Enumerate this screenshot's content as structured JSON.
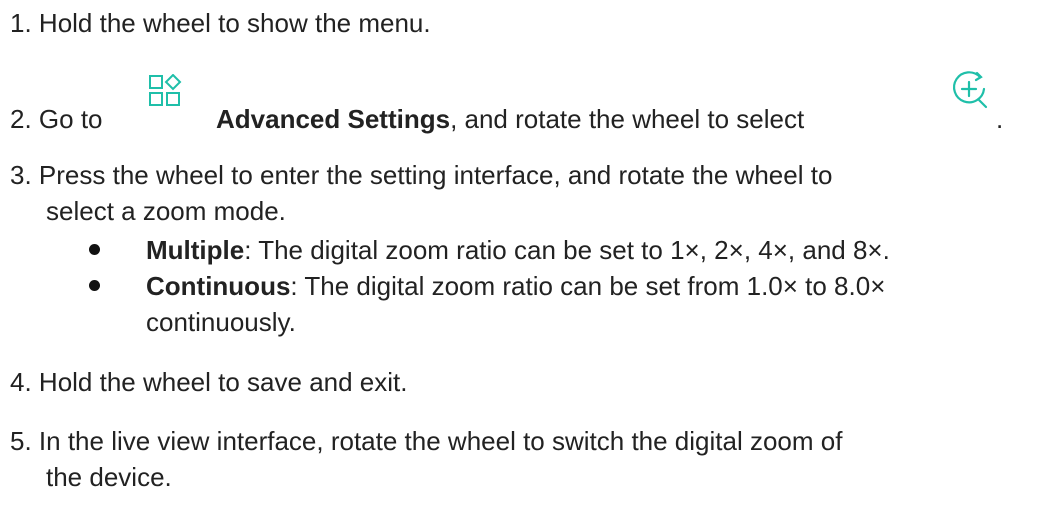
{
  "steps": [
    {
      "number": "1.",
      "text": "Hold the wheel to show the menu."
    },
    {
      "number": "2.",
      "pre": "Go to",
      "bold": "Advanced Settings",
      "post": ", and rotate the wheel to select",
      "end": "."
    },
    {
      "number": "3.",
      "text_line1": "Press the wheel to enter the setting interface, and rotate the wheel to",
      "text_line2": "select a zoom mode."
    },
    {
      "number": "4.",
      "text": "Hold the wheel to save and exit."
    },
    {
      "number": "5.",
      "text_line1": "In the live view interface, rotate the wheel to switch the digital zoom of",
      "text_line2": "the device."
    }
  ],
  "bullets": [
    {
      "bold": "Multiple",
      "text": ": The digital zoom ratio can be set to 1×, 2×, 4×, and 8×."
    },
    {
      "bold": "Continuous",
      "text_line1": ": The digital zoom ratio can be set from 1.0× to 8.0×",
      "text_line2": "continuously."
    }
  ],
  "icons": {
    "advanced_settings": "advanced-settings-icon",
    "zoom": "zoom-icon",
    "accent_color": "#1fbfa9"
  }
}
